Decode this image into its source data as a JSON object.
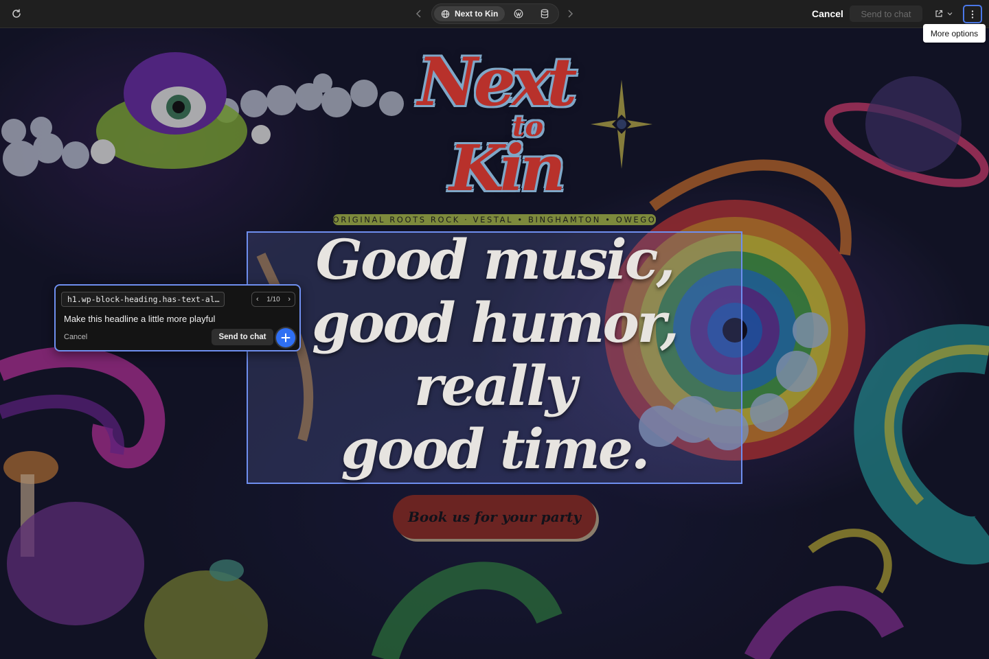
{
  "toolbar": {
    "site_name": "Next to Kin",
    "cancel_label": "Cancel",
    "send_label": "Send to chat",
    "more_tooltip": "More options"
  },
  "site": {
    "logo": {
      "line1": "Next",
      "line2": "to",
      "line3": "Kin"
    },
    "tagline": "ORIGINAL ROOTS ROCK · VESTAL • BINGHAMTON • OWEGO",
    "headline_lines": [
      "Good music,",
      "good humor,",
      "really",
      "good time."
    ],
    "cta_label": "Book us for your party"
  },
  "popover": {
    "selector": "h1.wp-block-heading.has-text-al…",
    "pager": "1/10",
    "prompt": "Make this headline a little more playful",
    "cancel_label": "Cancel",
    "send_label": "Send to chat"
  },
  "colors": {
    "accent": "#6f8ff0",
    "add_button": "#2f6ff3",
    "cta_bg": "#6b2422",
    "tagline_bg": "#7d8a3c"
  },
  "icons": [
    "reload-icon",
    "chevron-left-icon",
    "globe-icon",
    "wordpress-icon",
    "database-icon",
    "chevron-right-icon",
    "external-link-icon",
    "chevron-down-icon",
    "more-vertical-icon",
    "plus-icon"
  ]
}
